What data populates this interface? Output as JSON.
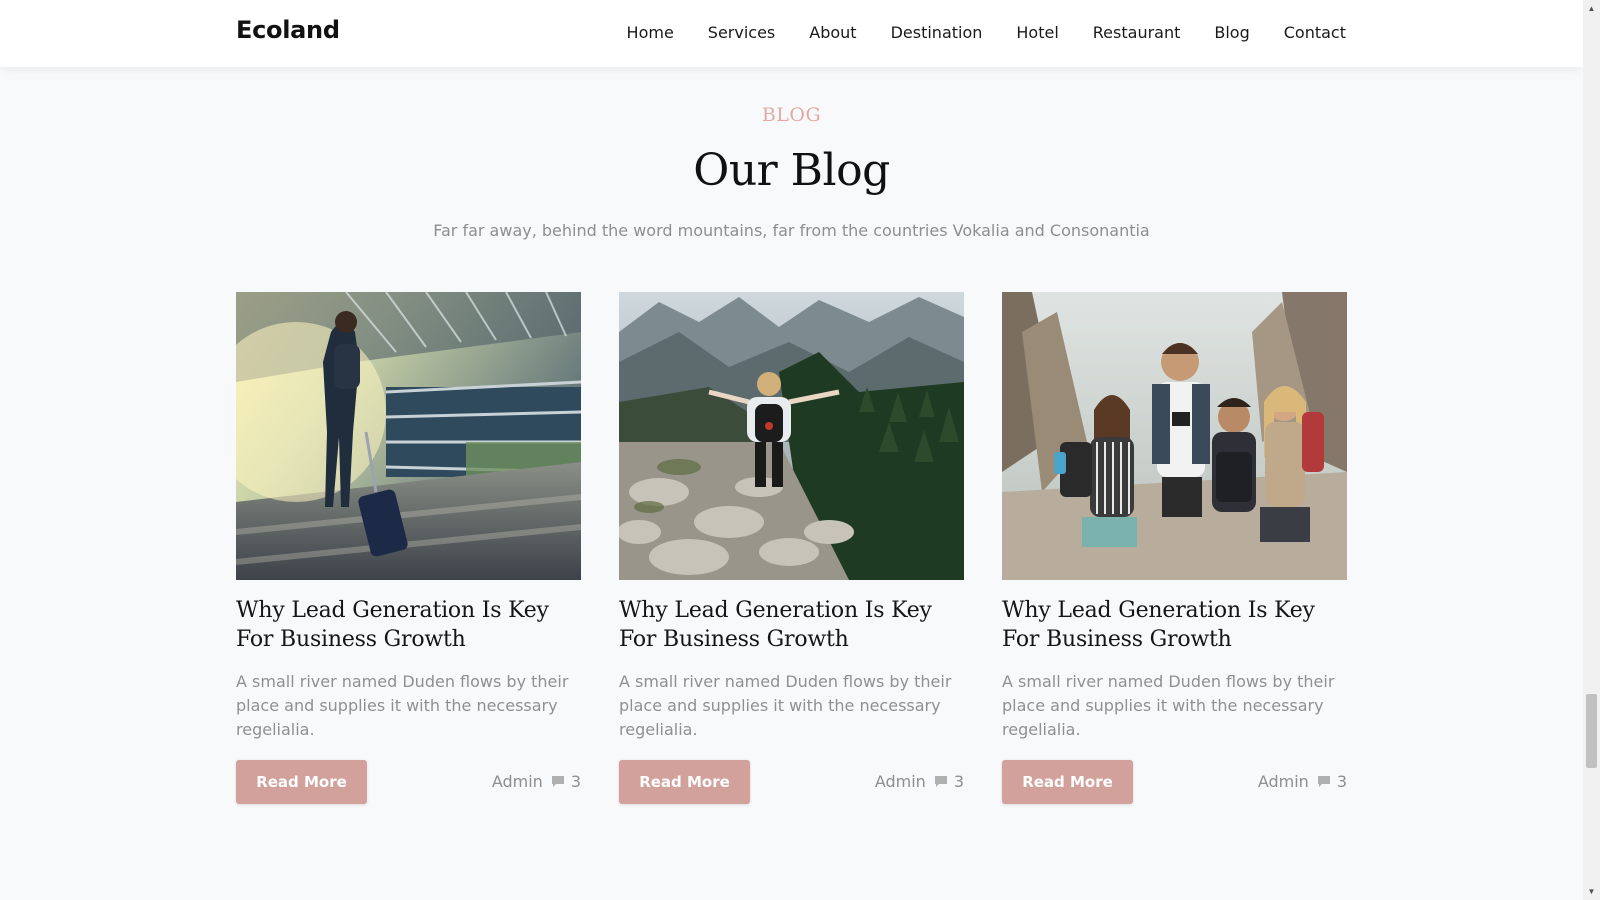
{
  "header": {
    "brand": "Ecoland",
    "nav": [
      "Home",
      "Services",
      "About",
      "Destination",
      "Hotel",
      "Restaurant",
      "Blog",
      "Contact"
    ]
  },
  "section": {
    "eyebrow": "BLOG",
    "title": "Our Blog",
    "subtitle": "Far far away, behind the word mountains, far from the countries Vokalia and Consonantia"
  },
  "posts": [
    {
      "image": "traveler-with-suitcase-photo",
      "title": "Why Lead Generation Is Key For Business Growth",
      "excerpt": "A small river named Duden flows by their place and supplies it with the necessary regelialia.",
      "button": "Read More",
      "author": "Admin",
      "comments": "3"
    },
    {
      "image": "hiker-on-mountain-trail-photo",
      "title": "Why Lead Generation Is Key For Business Growth",
      "excerpt": "A small river named Duden flows by their place and supplies it with the necessary regelialia.",
      "button": "Read More",
      "author": "Admin",
      "comments": "3"
    },
    {
      "image": "group-of-hikers-photo",
      "title": "Why Lead Generation Is Key For Business Growth",
      "excerpt": "A small river named Duden flows by their place and supplies it with the necessary regelialia.",
      "button": "Read More",
      "author": "Admin",
      "comments": "3"
    }
  ],
  "colors": {
    "accent": "#d2a19b",
    "eyebrow": "#e3aaa2",
    "muted_text": "#8e8e8e",
    "background": "#f8f9fb"
  },
  "icons": {
    "comment": "chat-bubble-icon",
    "scroll_up": "scroll-up-arrow-icon",
    "scroll_down": "scroll-down-arrow-icon"
  }
}
